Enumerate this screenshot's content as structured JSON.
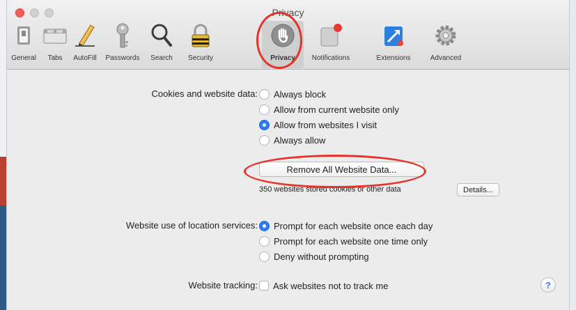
{
  "window": {
    "title": "Privacy"
  },
  "toolbar": {
    "items": [
      {
        "label": "General",
        "icon": "general-switch-icon"
      },
      {
        "label": "Tabs",
        "icon": "tabs-icon"
      },
      {
        "label": "AutoFill",
        "icon": "pencil-icon"
      },
      {
        "label": "Passwords",
        "icon": "key-icon"
      },
      {
        "label": "Search",
        "icon": "magnifier-icon"
      },
      {
        "label": "Security",
        "icon": "lock-icon"
      },
      {
        "label": "Privacy",
        "icon": "privacy-hand-icon",
        "selected": true
      },
      {
        "label": "Notifications",
        "icon": "notifications-icon"
      },
      {
        "label": "Extensions",
        "icon": "extensions-icon"
      },
      {
        "label": "Advanced",
        "icon": "gear-icon"
      }
    ]
  },
  "cookies": {
    "label": "Cookies and website data:",
    "options": [
      {
        "label": "Always block",
        "selected": false
      },
      {
        "label": "Allow from current website only",
        "selected": false
      },
      {
        "label": "Allow from websites I visit",
        "selected": true
      },
      {
        "label": "Always allow",
        "selected": false
      }
    ],
    "remove_button": "Remove All Website Data...",
    "stored_note": "350 websites stored cookies or other data",
    "details_button": "Details..."
  },
  "location": {
    "label": "Website use of location services:",
    "options": [
      {
        "label": "Prompt for each website once each day",
        "selected": true
      },
      {
        "label": "Prompt for each website one time only",
        "selected": false
      },
      {
        "label": "Deny without prompting",
        "selected": false
      }
    ]
  },
  "tracking": {
    "label": "Website tracking:",
    "checkbox_label": "Ask websites not to track me",
    "checked": false
  },
  "help": {
    "label": "?"
  },
  "colors": {
    "accent": "#2d7cf0",
    "annotation": "#e5332a",
    "close": "#f25f56"
  }
}
